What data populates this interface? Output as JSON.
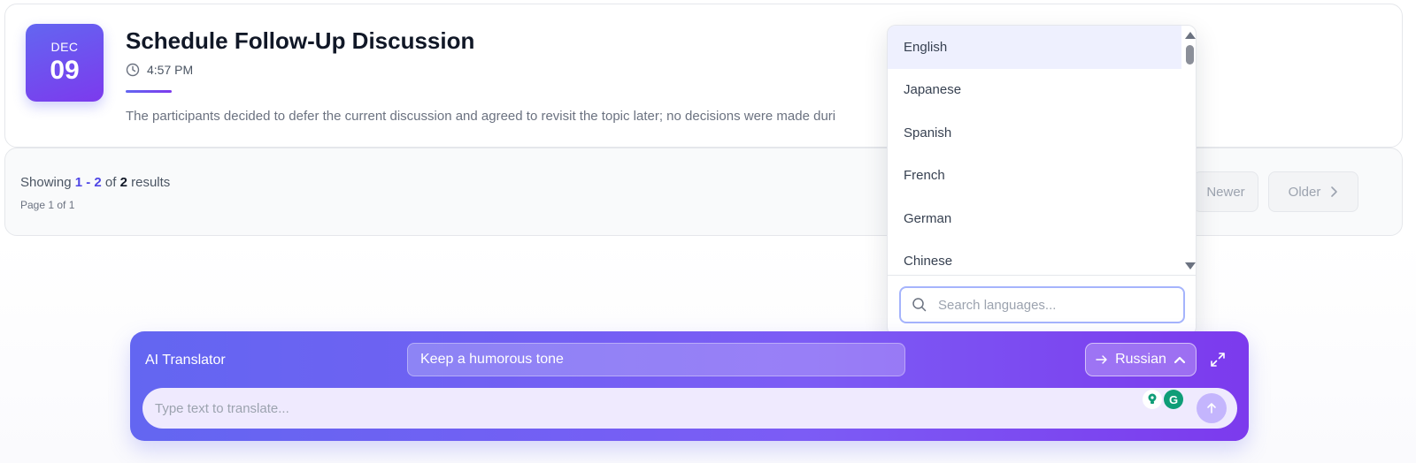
{
  "meeting_card": {
    "month": "DEC",
    "day": "09",
    "title": "Schedule Follow-Up Discussion",
    "time": "4:57 PM",
    "description": "The participants decided to defer the current discussion and agreed to revisit the topic later; no decisions were made duri"
  },
  "pagination": {
    "showing_prefix": "Showing",
    "range": "1 - 2",
    "of_label": "of",
    "total": "2",
    "results_label": "results",
    "page_info": "Page 1 of 1",
    "newer_label": "Newer",
    "older_label": "Older"
  },
  "language_dropdown": {
    "items": [
      "English",
      "Japanese",
      "Spanish",
      "French",
      "German",
      "Chinese"
    ],
    "highlighted": "English",
    "search_placeholder": "Search languages..."
  },
  "translator": {
    "title": "AI Translator",
    "tone_value": "Keep a humorous tone",
    "target_language": "Russian",
    "input_placeholder": "Type text to translate...",
    "extension_g_label": "G"
  },
  "colors": {
    "accent": "#6366f1",
    "accent_dark": "#7c3aed",
    "highlight_bg": "#eef0fe",
    "grammarly_green": "#0f9d77"
  }
}
